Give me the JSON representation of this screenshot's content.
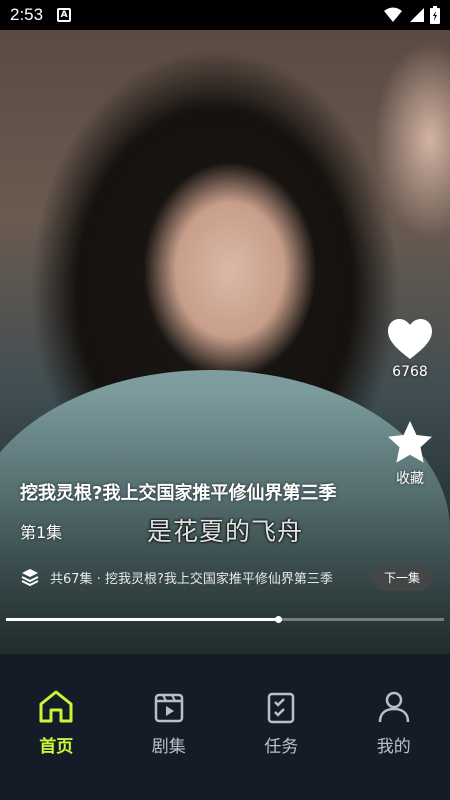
{
  "status_bar": {
    "time": "2:53",
    "notification_icon": "A"
  },
  "video": {
    "subtitle": "是花夏的飞舟",
    "title": "挖我灵根?我上交国家推平修仙界第三季",
    "episode": "第1集",
    "progress": 0.62
  },
  "actions": {
    "like_count": "6768",
    "favorite_label": "收藏"
  },
  "series": {
    "text": "共67集 · 挖我灵根?我上交国家推平修仙界第三季",
    "next_label": "下一集"
  },
  "nav": {
    "accent": "#c8f53a",
    "items": [
      {
        "label": "首页",
        "icon": "home-icon",
        "active": true
      },
      {
        "label": "剧集",
        "icon": "play-icon",
        "active": false
      },
      {
        "label": "任务",
        "icon": "task-icon",
        "active": false
      },
      {
        "label": "我的",
        "icon": "user-icon",
        "active": false
      }
    ]
  }
}
